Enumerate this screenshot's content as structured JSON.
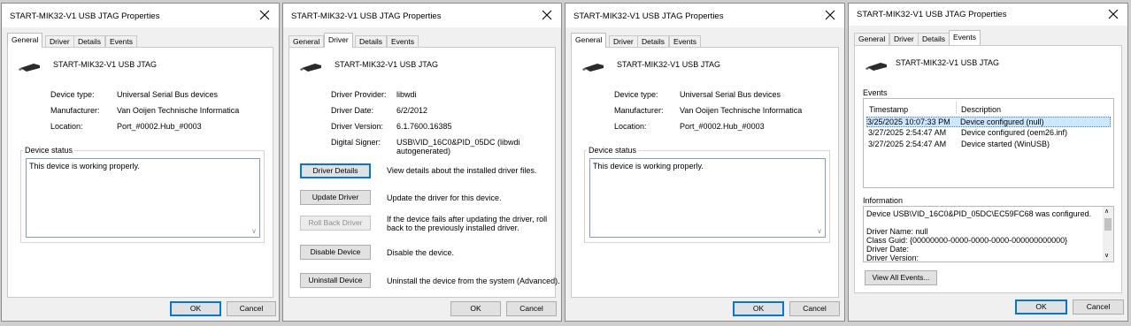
{
  "title": "START-MIK32-V1 USB JTAG Properties",
  "device_name": "START-MIK32-V1 USB JTAG",
  "tabs": [
    "General",
    "Driver",
    "Details",
    "Events"
  ],
  "general": {
    "labels": {
      "type": "Device type:",
      "manufacturer": "Manufacturer:",
      "location": "Location:"
    },
    "values": {
      "type": "Universal Serial Bus devices",
      "manufacturer": "Van Ooijen Technische Informatica",
      "location": "Port_#0002.Hub_#0003"
    },
    "status_label": "Device status",
    "status_text": "This device is working properly."
  },
  "driver": {
    "labels": {
      "provider": "Driver Provider:",
      "date": "Driver Date:",
      "version": "Driver Version:",
      "signer": "Digital Signer:"
    },
    "values": {
      "provider": "libwdi",
      "date": "6/2/2012",
      "version": "6.1.7600.16385",
      "signer": "USB\\VID_16C0&PID_05DC (libwdi autogenerated)"
    },
    "buttons": [
      {
        "label": "Driver Details",
        "desc": "View details about the installed driver files.",
        "enabled": true
      },
      {
        "label": "Update Driver",
        "desc": "Update the driver for this device.",
        "enabled": true
      },
      {
        "label": "Roll Back Driver",
        "desc": "If the device fails after updating the driver, roll back to the previously installed driver.",
        "enabled": false
      },
      {
        "label": "Disable Device",
        "desc": "Disable the device.",
        "enabled": true
      },
      {
        "label": "Uninstall Device",
        "desc": "Uninstall the device from the system (Advanced).",
        "enabled": true
      }
    ]
  },
  "events": {
    "section_label": "Events",
    "columns": [
      "Timestamp",
      "Description"
    ],
    "rows": [
      {
        "timestamp": "3/25/2025 10:07:33 PM",
        "description": "Device configured (null)",
        "selected": true
      },
      {
        "timestamp": "3/27/2025 2:54:47 AM",
        "description": "Device configured (oem26.inf)",
        "selected": false
      },
      {
        "timestamp": "3/27/2025 2:54:47 AM",
        "description": "Device started (WinUSB)",
        "selected": false
      }
    ],
    "info_label": "Information",
    "info_lines": [
      "Device USB\\VID_16C0&PID_05DC\\EC59FC68 was configured.",
      "",
      "Driver Name: null",
      "Class Guid: {00000000-0000-0000-0000-000000000000}",
      "Driver Date:",
      "Driver Version:"
    ],
    "view_all_label": "View All Events..."
  },
  "ok_label": "OK",
  "cancel_label": "Cancel",
  "accent_color": "#0078d7"
}
